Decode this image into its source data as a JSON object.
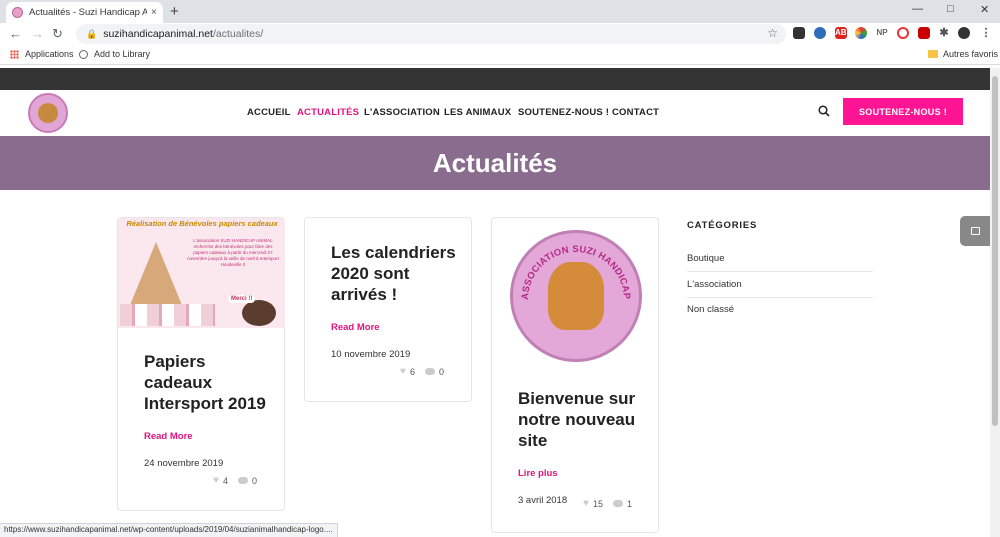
{
  "browser": {
    "tab_title": "Actualités - Suzi Handicap Animal",
    "tab_close": "×",
    "new_tab": "+",
    "url_domain": "suzihandicapanimal.net",
    "url_path": "/actualites/",
    "bookmarks": [
      "Applications",
      "Add to Library"
    ],
    "other_bookmarks": "Autres favoris",
    "ext_labels": [
      "ABP",
      "NP"
    ],
    "status_url": "https://www.suzihandicapanimal.net/wp-content/uploads/2019/04/suzianimalhandicap-logo...."
  },
  "nav": {
    "items": [
      "ACCUEIL",
      "ACTUALITÉS",
      "L'ASSOCIATION",
      "LES ANIMAUX",
      "SOUTENEZ-NOUS !",
      "CONTACT"
    ],
    "active_index": 1,
    "cta": "SOUTENEZ-NOUS !"
  },
  "hero": {
    "title": "Actualités"
  },
  "posts": [
    {
      "title": "Papiers cadeaux Intersport 2019",
      "more": "Read More",
      "date": "24 novembre 2019",
      "likes": "4",
      "comments": "0",
      "image_banner": "Réalisation de Bénévoles papiers cadeaux",
      "image_text": "L'association SUZI HANDICAP ANIMAL recherche des bénévoles pour faire des papiers cadeaux à partir du mercredi 27 novembre jusqu'à la veille de noël à Intersport Houdeville 2",
      "image_bubble": "Merci !!"
    },
    {
      "title": "Les calendriers 2020 sont arrivés !",
      "more": "Read More",
      "date": "10 novembre 2019",
      "likes": "6",
      "comments": "0"
    },
    {
      "title": "Bienvenue sur notre nouveau site",
      "more": "Lire plus",
      "date": "3 avril 2018",
      "likes": "15",
      "comments": "1",
      "image_ring_text": "ASSOCIATION SUZI HANDICAP ANIMAL"
    }
  ],
  "sidebar": {
    "title": "CATÉGORIES",
    "items": [
      "Boutique",
      "L'association",
      "Non classé"
    ]
  },
  "colors": {
    "accent": "#e0137e",
    "cta_bg": "#ff1493",
    "hero_bg": "#8a6d8e",
    "topbar": "#333333"
  }
}
